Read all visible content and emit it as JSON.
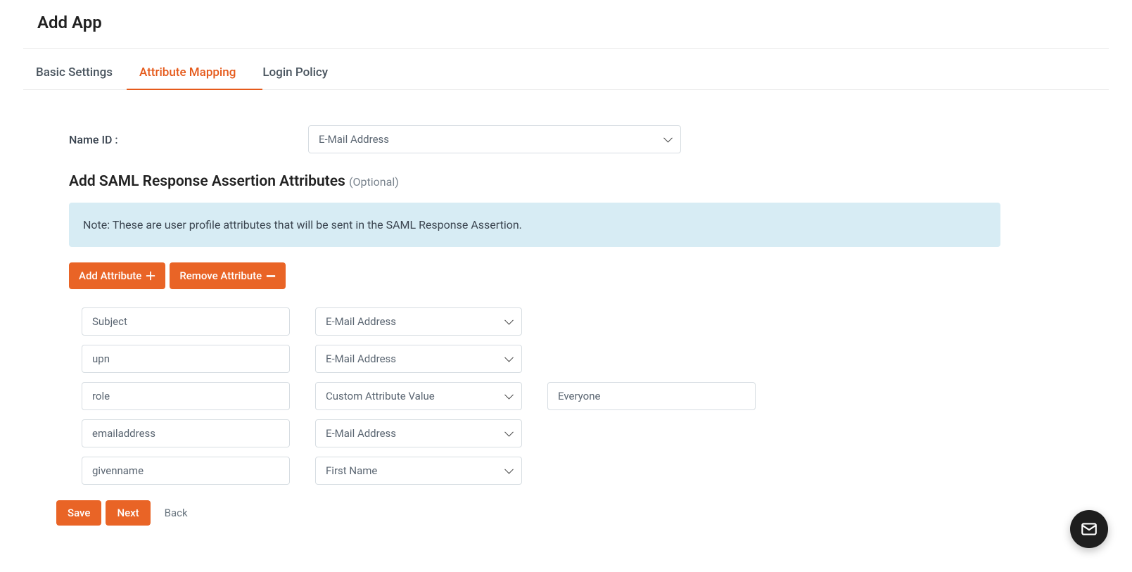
{
  "page_title": "Add App",
  "tabs": [
    {
      "label": "Basic Settings",
      "active": false
    },
    {
      "label": "Attribute Mapping",
      "active": true
    },
    {
      "label": "Login Policy",
      "active": false
    }
  ],
  "name_id": {
    "label": "Name ID :",
    "selected": "E-Mail Address"
  },
  "section": {
    "heading": "Add SAML Response Assertion Attributes",
    "optional": "(Optional)"
  },
  "note": "Note: These are user profile attributes that will be sent in the SAML Response Assertion.",
  "buttons": {
    "add_attribute": "Add Attribute",
    "remove_attribute": "Remove Attribute",
    "save": "Save",
    "next": "Next",
    "back": "Back"
  },
  "attributes": [
    {
      "name": "Subject",
      "value": "E-Mail Address",
      "custom": ""
    },
    {
      "name": "upn",
      "value": "E-Mail Address",
      "custom": ""
    },
    {
      "name": "role",
      "value": "Custom Attribute Value",
      "custom": "Everyone"
    },
    {
      "name": "emailaddress",
      "value": "E-Mail Address",
      "custom": ""
    },
    {
      "name": "givenname",
      "value": "First Name",
      "custom": ""
    }
  ]
}
